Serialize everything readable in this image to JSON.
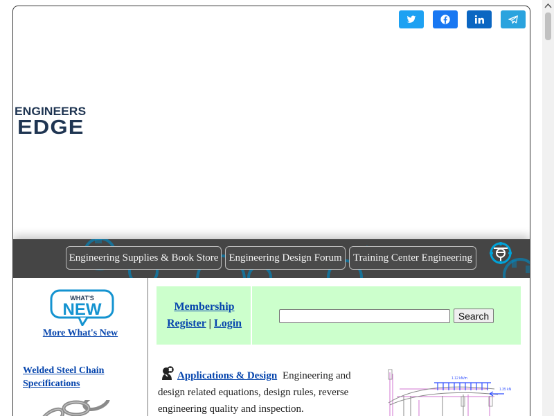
{
  "share": {
    "buttons": [
      {
        "icon": "twitter-icon",
        "color": "#1da1f2"
      },
      {
        "icon": "facebook-icon",
        "color": "#1877f2"
      },
      {
        "icon": "linkedin-icon",
        "color": "#0a66c2"
      },
      {
        "icon": "telegram-icon",
        "color": "#2aa3de"
      }
    ]
  },
  "brand": {
    "line1": "ENGINEERS",
    "line2": "EDGE",
    "color": "#1f3552"
  },
  "nav": {
    "items": [
      "Engineering Supplies & Book Store",
      "Engineering Design Forum",
      "Training Center Engineering"
    ],
    "background": "#454545",
    "accent": "#00a3d9"
  },
  "sidebar": {
    "whats_new_badge": {
      "top": "WHAT'S",
      "bottom": "NEW"
    },
    "whats_new_link": "More What's New",
    "chain_link": "Welded Steel Chain Specifications"
  },
  "membership": {
    "label": "Membership",
    "register": "Register",
    "separator": "|",
    "login": "Login",
    "background": "#ccffcc"
  },
  "search": {
    "placeholder": "",
    "value": "",
    "button": "Search"
  },
  "applications": {
    "title": "Applications & Design",
    "description": "Engineering and design related equations, design rules, reverse engineering quality and inspection."
  },
  "diagram": {
    "load_label": "1.12 kN/m",
    "force_label": "1.35 kN"
  }
}
